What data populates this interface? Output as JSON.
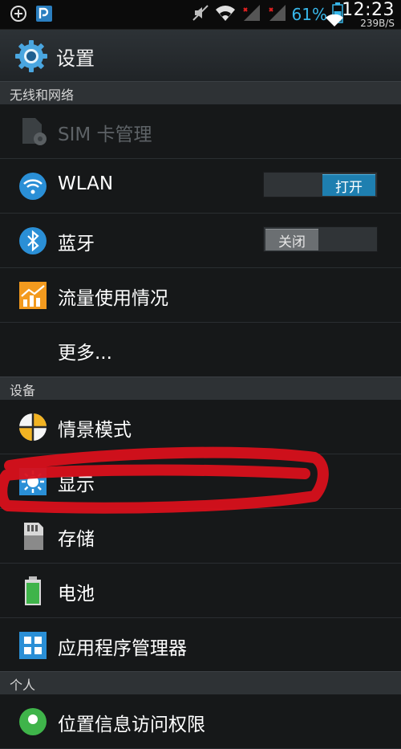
{
  "status_bar": {
    "battery_percent": "61%",
    "time": "12:23",
    "net_speed": "239B/S"
  },
  "action_bar": {
    "title": "设置"
  },
  "sections": {
    "wireless": "无线和网络",
    "device": "设备",
    "personal": "个人"
  },
  "items": {
    "sim": {
      "label": "SIM 卡管理"
    },
    "wlan": {
      "label": "WLAN",
      "toggle": "打开"
    },
    "bluetooth": {
      "label": "蓝牙",
      "toggle": "关闭"
    },
    "data_usage": {
      "label": "流量使用情况"
    },
    "more": {
      "label": "更多..."
    },
    "profiles": {
      "label": "情景模式"
    },
    "display": {
      "label": "显示"
    },
    "storage": {
      "label": "存储"
    },
    "battery": {
      "label": "电池"
    },
    "apps": {
      "label": "应用程序管理器"
    },
    "location": {
      "label": "位置信息访问权限"
    }
  },
  "colors": {
    "accent": "#1e7fb0",
    "scribble": "#d8101b"
  }
}
